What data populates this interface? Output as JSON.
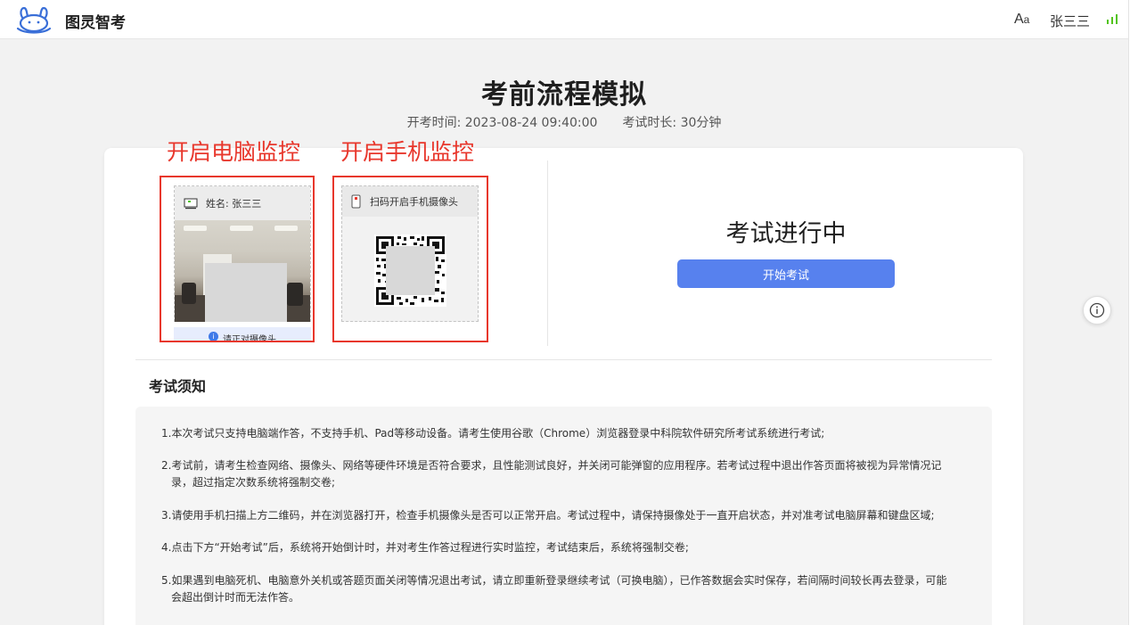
{
  "header": {
    "brand": "图灵智考",
    "font_toggle_main": "A",
    "font_toggle_small": "a",
    "username": "张三三"
  },
  "page": {
    "title": "考前流程模拟",
    "start_time_label": "开考时间: 2023-08-24 09:40:00",
    "duration_label": "考试时长: 30分钟"
  },
  "annotations": {
    "pc": "开启电脑监控",
    "phone": "开启手机监控"
  },
  "pc_monitor": {
    "name_label": "姓名: 张三三",
    "tip": "请正对摄像头",
    "icon": "monitor-icon"
  },
  "phone_monitor": {
    "label": "扫码开启手机摄像头",
    "icon": "phone-icon"
  },
  "exam": {
    "status": "考试进行中",
    "start_button": "开始考试"
  },
  "notice": {
    "title": "考试须知",
    "rules": [
      {
        "line1": "1.本次考试只支持电脑端作答，不支持手机、Pad等移动设备。请考生使用谷歌（Chrome）浏览器登录中科院软件研究所考试系统进行考试;",
        "line2": ""
      },
      {
        "line1": "2.考试前，请考生检查网络、摄像头、网络等硬件环境是否符合要求，且性能测试良好，并关闭可能弹窗的应用程序。若考试过程中退出作答页面将被视为异常情况记",
        "line2": "录，超过指定次数系统将强制交卷;"
      },
      {
        "line1": "3.请使用手机扫描上方二维码，并在浏览器打开，检查手机摄像头是否可以正常开启。考试过程中，请保持摄像处于一直开启状态，并对准考试电脑屏幕和键盘区域;",
        "line2": ""
      },
      {
        "line1": "4.点击下方“开始考试”后，系统将开始倒计时，并对考生作答过程进行实时监控，考试结束后，系统将强制交卷;",
        "line2": ""
      },
      {
        "line1": "5.如果遇到电脑死机、电脑意外关机或答题页面关闭等情况退出考试，请立即重新登录继续考试（可换电脑），已作答数据会实时保存，若间隔时间较长再去登录，可能",
        "line2": "会超出倒计时而无法作答。"
      }
    ]
  },
  "colors": {
    "accent": "#5781ee",
    "annotation": "#e8372c",
    "signal": "#52c41a"
  }
}
